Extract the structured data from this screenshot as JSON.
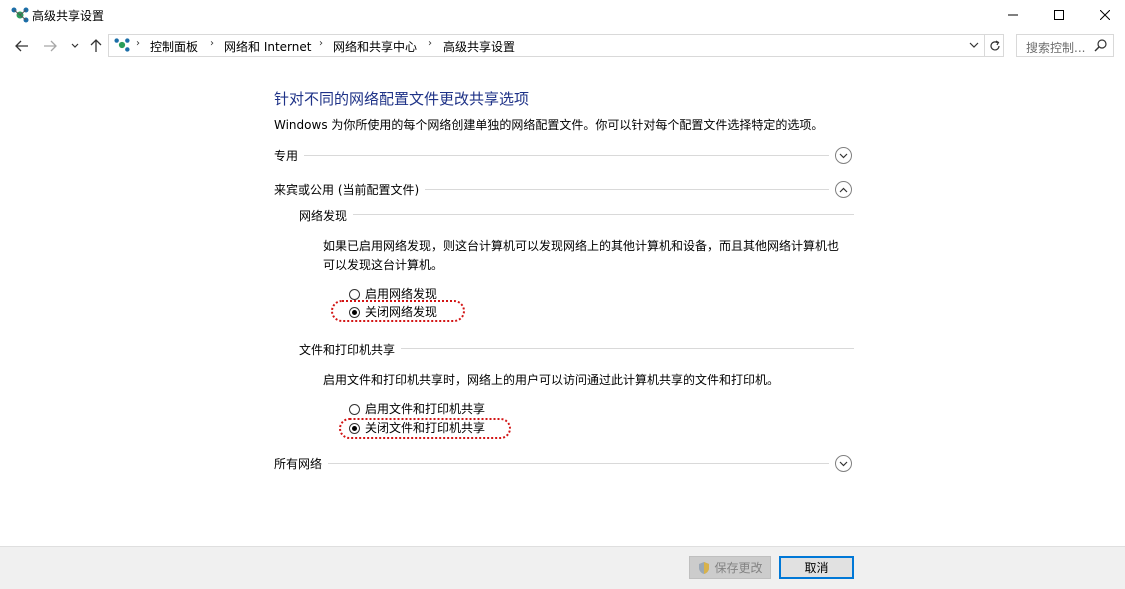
{
  "window": {
    "title": "高级共享设置",
    "controls": {
      "minimize": "—",
      "maximize": "☐",
      "close": "✕"
    }
  },
  "address": {
    "breadcrumbs": [
      "控制面板",
      "网络和 Internet",
      "网络和共享中心",
      "高级共享设置"
    ],
    "separator": "›",
    "search_placeholder": "搜索控制..."
  },
  "content": {
    "title": "针对不同的网络配置文件更改共享选项",
    "description": "Windows 为你所使用的每个网络创建单独的网络配置文件。你可以针对每个配置文件选择特定的选项。",
    "profiles": [
      {
        "label": "专用",
        "state": "collapsed"
      },
      {
        "label": "来宾或公用 (当前配置文件)",
        "state": "expanded"
      },
      {
        "label": "所有网络",
        "state": "collapsed"
      }
    ],
    "network_discovery": {
      "heading": "网络发现",
      "text_line1": "如果已启用网络发现，则这台计算机可以发现网络上的其他计算机和设备，而且其他网络计算机也",
      "text_line2": "可以发现这台计算机。",
      "options": [
        {
          "label": "启用网络发现",
          "selected": false
        },
        {
          "label": "关闭网络发现",
          "selected": true
        }
      ]
    },
    "file_printer_sharing": {
      "heading": "文件和打印机共享",
      "text": "启用文件和打印机共享时，网络上的用户可以访问通过此计算机共享的文件和打印机。",
      "options": [
        {
          "label": "启用文件和打印机共享",
          "selected": false
        },
        {
          "label": "关闭文件和打印机共享",
          "selected": true
        }
      ]
    }
  },
  "footer": {
    "save_label": "保存更改",
    "cancel_label": "取消"
  },
  "colors": {
    "title_blue": "#1e3287",
    "highlight_red": "#d21414",
    "focus_blue": "#0078d7"
  }
}
